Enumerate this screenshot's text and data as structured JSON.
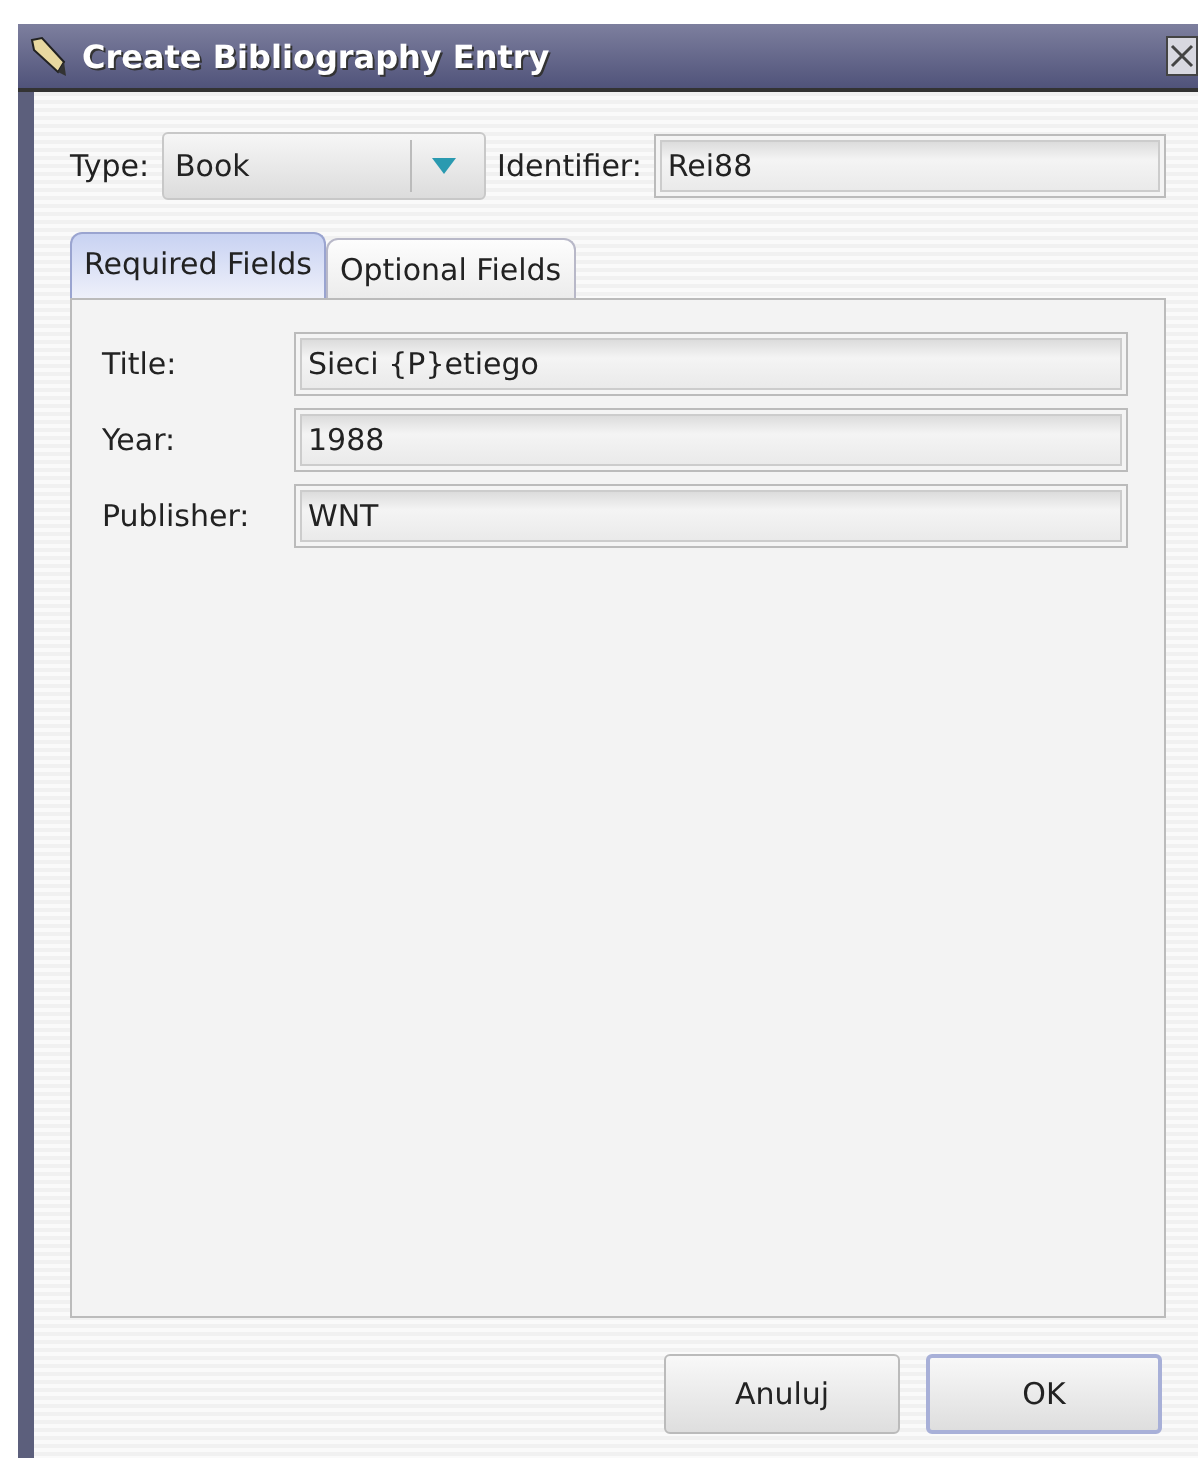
{
  "window": {
    "title": "Create Bibliography Entry"
  },
  "type_field": {
    "label": "Type:",
    "value": "Book"
  },
  "identifier_field": {
    "label": "Identifier:",
    "value": "Rei88"
  },
  "tabs": [
    {
      "label": "Required Fields",
      "selected": true
    },
    {
      "label": "Optional Fields",
      "selected": false
    }
  ],
  "fields": [
    {
      "label": "Title:",
      "value": "Sieci {P}etiego"
    },
    {
      "label": "Year:",
      "value": "1988"
    },
    {
      "label": "Publisher:",
      "value": "WNT"
    }
  ],
  "buttons": [
    {
      "label": "Anuluj",
      "default": false
    },
    {
      "label": "OK",
      "default": true
    }
  ]
}
